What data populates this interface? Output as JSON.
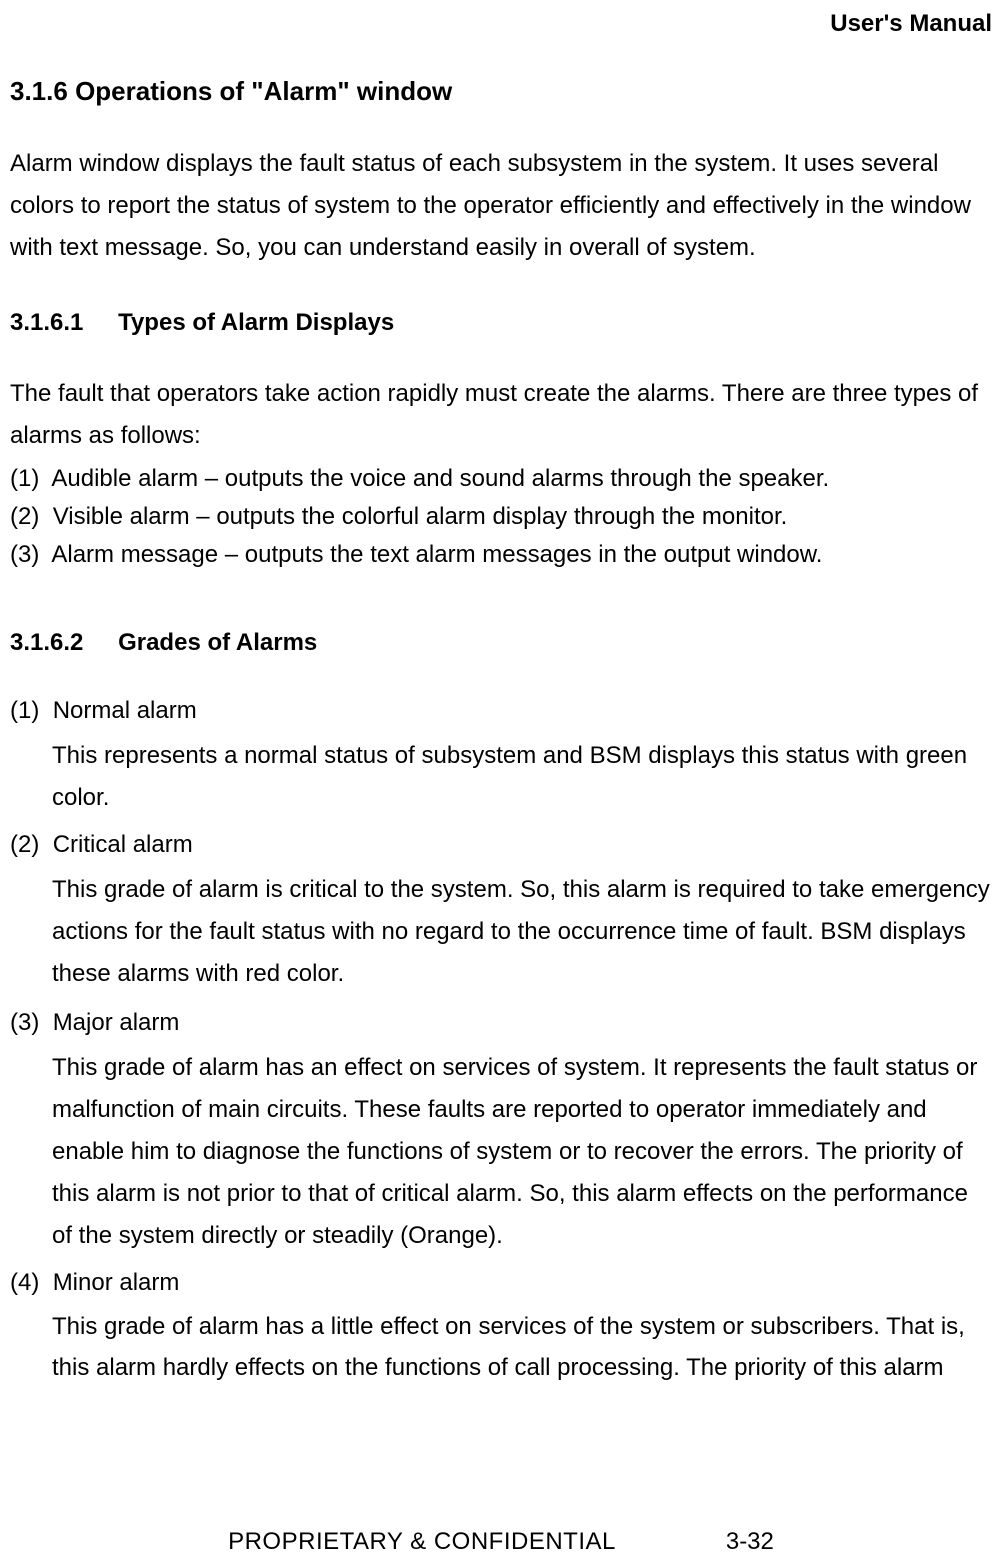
{
  "header": {
    "title": "User's Manual"
  },
  "section": {
    "number": "3.1.6",
    "title": "Operations of \"Alarm\" window",
    "intro": "Alarm window displays the fault status of each subsystem in the system. It uses several colors to report the status of system to the operator efficiently and effectively in the window with text message. So, you can understand easily in overall of system."
  },
  "sub1": {
    "number": "3.1.6.1",
    "title": "Types of Alarm Displays",
    "intro": "The fault that operators take action rapidly must create the alarms. There are three types of alarms as follows:",
    "items": [
      {
        "marker": "(1)",
        "text": "Audible alarm – outputs the voice and sound alarms through the speaker."
      },
      {
        "marker": "(2)",
        "text": "Visible alarm – outputs the colorful alarm display through the monitor."
      },
      {
        "marker": "(3)",
        "text": "Alarm message – outputs the text alarm messages in the output window."
      }
    ]
  },
  "sub2": {
    "number": "3.1.6.2",
    "title": "Grades of Alarms",
    "items": [
      {
        "marker": "(1)",
        "name": "Normal alarm",
        "body": "This represents a normal status of subsystem and BSM displays this status with green color."
      },
      {
        "marker": "(2)",
        "name": "Critical alarm",
        "body": "This grade of alarm is critical to the system. So, this alarm is required to take emergency actions for the fault status with no regard to the occurrence time of fault. BSM displays these alarms with red color."
      },
      {
        "marker": "(3)",
        "name": "Major alarm",
        "body": "This grade of alarm has an effect on services of system. It represents the fault status or malfunction of main circuits. These faults are reported to operator immediately and enable him to diagnose the functions of system or to recover the errors. The priority of this alarm is not prior to that of critical alarm. So, this alarm effects on the performance of the system directly or steadily (Orange)."
      },
      {
        "marker": "(4)",
        "name": "Minor alarm",
        "body": "This grade of alarm has a little effect on services of the system or subscribers. That is, this alarm hardly effects on the functions of call processing. The priority of this alarm"
      }
    ]
  },
  "footer": {
    "left": "PROPRIETARY & CONFIDENTIAL",
    "right": "3-32"
  }
}
